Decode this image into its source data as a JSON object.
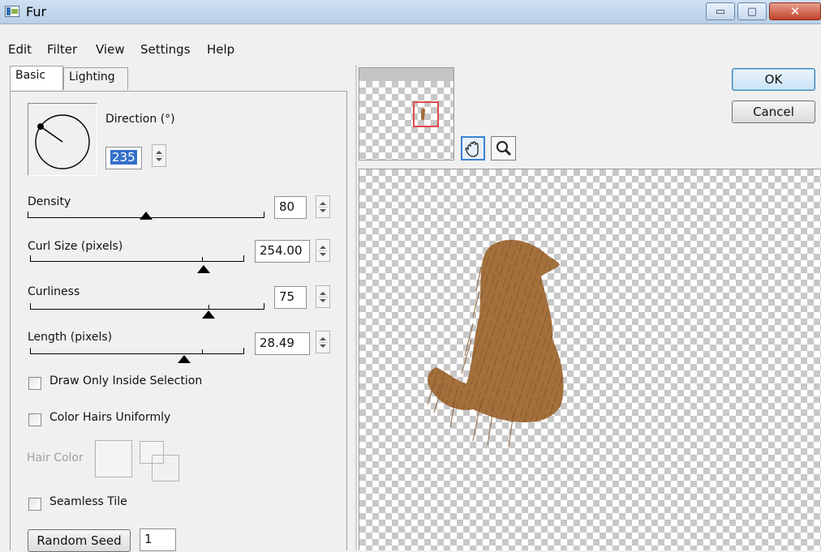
{
  "window": {
    "title": "Fur",
    "controls": {
      "minimize": "▭",
      "maximize": "▢",
      "close": "✕"
    }
  },
  "menu": [
    "Edit",
    "Filter",
    "View",
    "Settings",
    "Help"
  ],
  "tabs": {
    "basic": "Basic",
    "lighting": "Lighting",
    "active": "Basic"
  },
  "direction": {
    "label": "Direction (°)",
    "value": "235"
  },
  "sliders": [
    {
      "label": "Density",
      "value": "80",
      "level": 0.5
    },
    {
      "label": "Curl Size (pixels)",
      "value": "254.00",
      "level": 0.81
    },
    {
      "label": "Curliness",
      "value": "75",
      "level": 0.76
    },
    {
      "label": "Length (pixels)",
      "value": "28.49",
      "level": 0.72
    }
  ],
  "checkboxes": {
    "draw_inside": {
      "label": "Draw Only Inside Selection",
      "checked": false
    },
    "color_uniform": {
      "label": "Color Hairs Uniformly",
      "checked": false
    },
    "seamless": {
      "label": "Seamless Tile",
      "checked": false
    }
  },
  "hair_color": {
    "label": "Hair Color"
  },
  "random_seed": {
    "button": "Random Seed",
    "value": "1"
  },
  "buttons": {
    "ok": "OK",
    "cancel": "Cancel"
  },
  "tools": {
    "hand": "hand-tool-icon",
    "zoom": "zoom-tool-icon",
    "active": "hand"
  },
  "colors": {
    "fur": "#a36f3b",
    "fur_dark": "#6b4423",
    "accent": "#3b82cf"
  }
}
